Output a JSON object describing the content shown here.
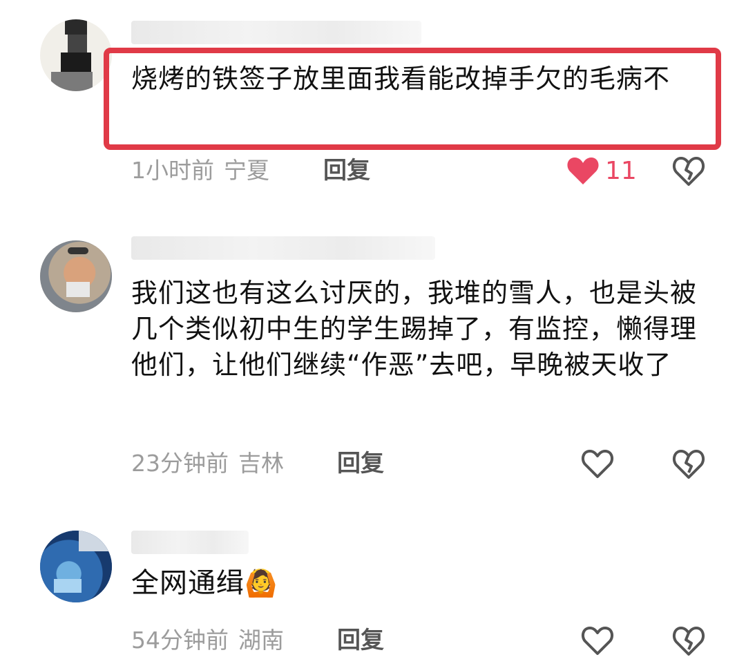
{
  "comments": [
    {
      "text": "烧烤的铁签子放里面我看能改掉手欠的毛病不",
      "time": "1小时前",
      "location": "宁夏",
      "reply_label": "回复",
      "likes": "11",
      "liked": true,
      "highlighted": true
    },
    {
      "text": "我们这也有这么讨厌的，我堆的雪人，也是头被几个类似初中生的学生踢掉了，有监控，懒得理他们，让他们继续“作恶”去吧，早晚被天收了",
      "time": "23分钟前",
      "location": "吉林",
      "reply_label": "回复",
      "liked": false
    },
    {
      "text": "全网通缉",
      "emoji": "🙆",
      "time": "54分钟前",
      "location": "湖南",
      "reply_label": "回复",
      "liked": false
    }
  ],
  "colors": {
    "highlight_border": "#e03a47",
    "like_active": "#ea4763",
    "meta_text": "#9c9c9c"
  },
  "icons": {
    "like": "heart-icon",
    "dislike": "broken-heart-icon"
  }
}
